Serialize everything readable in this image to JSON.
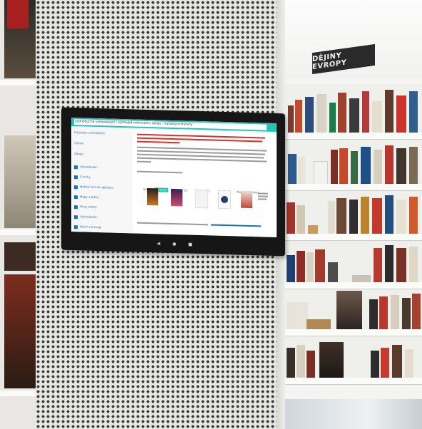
{
  "scene": {
    "description_colors": {
      "pillar": "#e6e6e3",
      "accent": "#25c4bb",
      "monitor": "#161616"
    }
  },
  "sign": {
    "label": "DĚJINY EVROPY"
  },
  "screen": {
    "breadcrumb": "Jednoduché vyhledávání › Vyhledat informační zdroje › Katalog knihovny",
    "sidebar": [
      "Průvodce vyhledáním",
      "Článek",
      "Zdroje",
      "Vyhledávání",
      "E-knihy",
      "Mobilní formát aplikace",
      "Mapy a plány",
      "Filmy (DVD)",
      "Vyhledávání",
      "Návrh na koupi"
    ],
    "tabs": [
      "Vše",
      "E-knihy",
      "Audio CD",
      "Filmy DVD",
      "Články",
      "Mapy",
      "Noty"
    ]
  }
}
